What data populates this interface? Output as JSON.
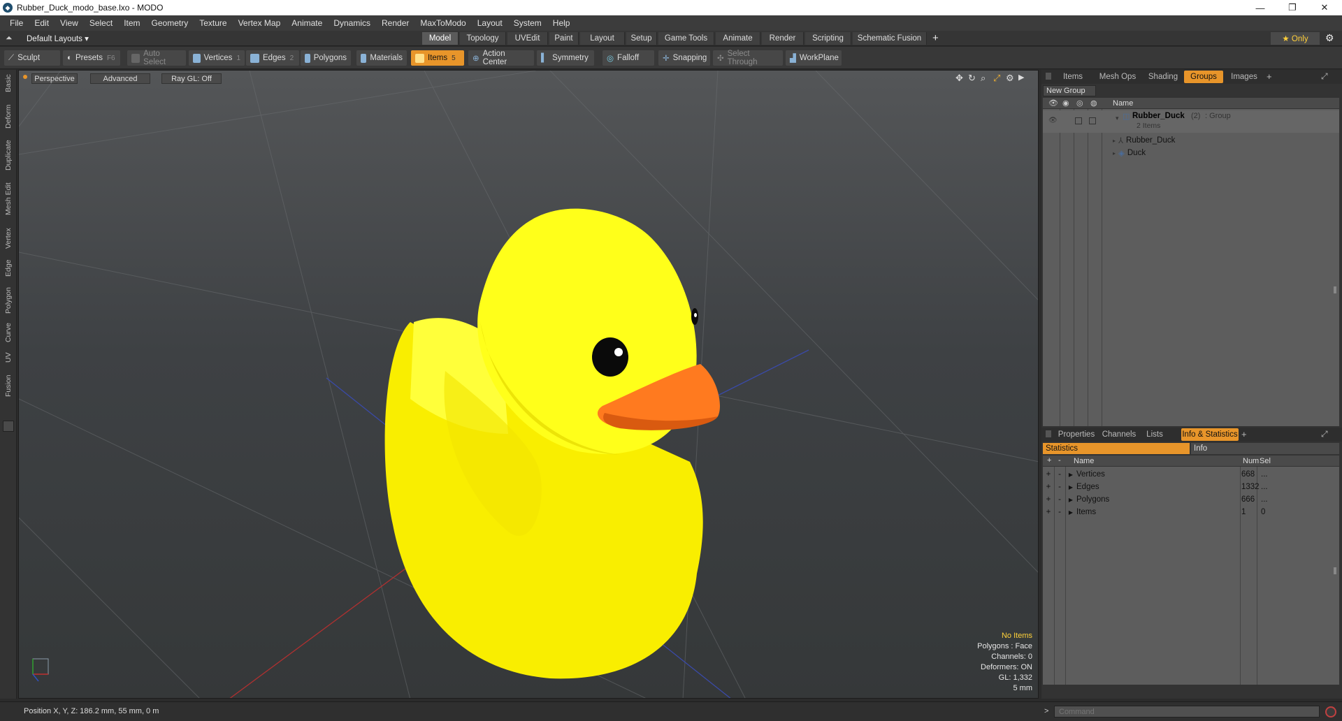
{
  "window": {
    "title": "Rubber_Duck_modo_base.lxo - MODO",
    "controls": [
      "—",
      "❐",
      "✕"
    ]
  },
  "menu": [
    "File",
    "Edit",
    "View",
    "Select",
    "Item",
    "Geometry",
    "Texture",
    "Vertex Map",
    "Animate",
    "Dynamics",
    "Render",
    "MaxToModo",
    "Layout",
    "System",
    "Help"
  ],
  "layout": {
    "preset": "Default Layouts ▾",
    "tabs": [
      "Model",
      "Topology",
      "UVEdit",
      "Paint",
      "Layout",
      "Setup",
      "Game Tools",
      "Animate",
      "Render",
      "Scripting",
      "Schematic Fusion"
    ],
    "active_tab": "Model",
    "add": "+",
    "only_label": "★  Only"
  },
  "toolbar": {
    "sculpt": "Sculpt",
    "presets": "Presets",
    "presets_key": "F6",
    "auto_select": "Auto Select",
    "vertices": "Vertices",
    "vertices_key": "1",
    "edges": "Edges",
    "edges_key": "2",
    "polygons": "Polygons",
    "materials": "Materials",
    "items": "Items",
    "items_key": "5",
    "action_center": "Action Center",
    "symmetry": "Symmetry",
    "falloff": "Falloff",
    "snapping": "Snapping",
    "select_through": "Select Through",
    "workplane": "WorkPlane"
  },
  "sidetabs": [
    "Basic",
    "Deform",
    "Duplicate",
    "Mesh Edit",
    "Vertex",
    "Edge",
    "Polygon",
    "Curve",
    "UV",
    "Fusion"
  ],
  "viewport": {
    "view": "Perspective",
    "shading": "Advanced",
    "raygl": "Ray GL: Off",
    "hud": {
      "no_items": "No Items",
      "polygons": "Polygons : Face",
      "channels": "Channels: 0",
      "deformers": "Deformers: ON",
      "gl": "GL: 1,332",
      "scale": "5 mm"
    }
  },
  "groups_panel": {
    "tabs": [
      "Items",
      "Mesh Ops",
      "Shading",
      "Groups",
      "Images"
    ],
    "active_tab": "Groups",
    "new_group": "New Group",
    "name_header": "Name",
    "group": {
      "name": "Rubber_Duck",
      "count": "(2)",
      "type": ": Group",
      "items": "2 Items"
    },
    "children": [
      "Rubber_Duck",
      "Duck"
    ]
  },
  "info_panel": {
    "tabs": [
      "Properties",
      "Channels",
      "Lists",
      "Info & Statistics"
    ],
    "active_tab": "Info & Statistics",
    "subtabs": [
      "Statistics",
      "Info"
    ],
    "headers": {
      "name": "Name",
      "num": "Num",
      "sel": "Sel"
    },
    "rows": [
      {
        "name": "Vertices",
        "num": "668",
        "sel": "..."
      },
      {
        "name": "Edges",
        "num": "1332",
        "sel": "..."
      },
      {
        "name": "Polygons",
        "num": "666",
        "sel": "..."
      },
      {
        "name": "Items",
        "num": "1",
        "sel": "0"
      }
    ]
  },
  "status": {
    "position": "Position X, Y, Z:   186.2 mm, 55 mm, 0 m",
    "command_placeholder": "Command",
    "prompt": ">"
  },
  "colors": {
    "accent": "#e8952a",
    "duck": "#ffee00",
    "beak": "#ff7a1f"
  }
}
